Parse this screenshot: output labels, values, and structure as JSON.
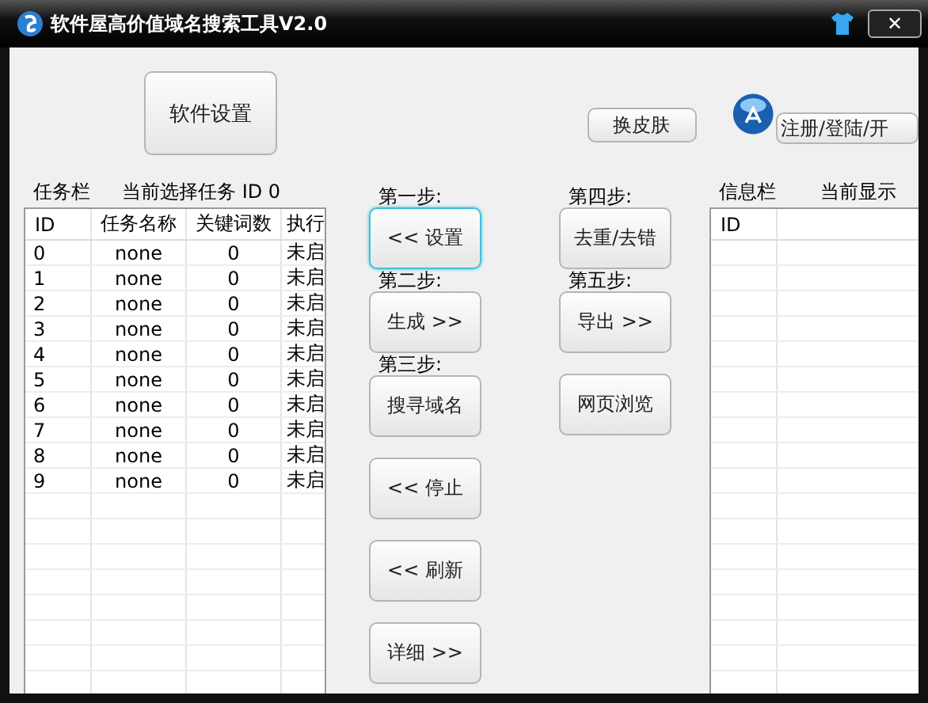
{
  "window": {
    "title": "软件屋高价值域名搜索工具V2.0",
    "close": "✕"
  },
  "toolbar": {
    "settings_button": "软件设置",
    "skin_button": "换皮肤",
    "login_button": "注册/登陆/开"
  },
  "task_panel": {
    "title": "任务栏",
    "current": "当前选择任务 ID 0",
    "columns": [
      "ID",
      "任务名称",
      "关键词数",
      "执行"
    ],
    "rows": [
      [
        "0",
        "none",
        "0",
        "未启"
      ],
      [
        "1",
        "none",
        "0",
        "未启"
      ],
      [
        "2",
        "none",
        "0",
        "未启"
      ],
      [
        "3",
        "none",
        "0",
        "未启"
      ],
      [
        "4",
        "none",
        "0",
        "未启"
      ],
      [
        "5",
        "none",
        "0",
        "未启"
      ],
      [
        "6",
        "none",
        "0",
        "未启"
      ],
      [
        "7",
        "none",
        "0",
        "未启"
      ],
      [
        "8",
        "none",
        "0",
        "未启"
      ],
      [
        "9",
        "none",
        "0",
        "未启"
      ]
    ]
  },
  "steps": [
    [
      {
        "kind": "label",
        "text": "第一步:"
      },
      {
        "kind": "button",
        "text": "<< 设置",
        "focused": true
      },
      {
        "kind": "label",
        "text": "第二步:"
      },
      {
        "kind": "button",
        "text": "生成 >>",
        "focused": false
      },
      {
        "kind": "label",
        "text": "第三步:"
      },
      {
        "kind": "button",
        "text": "搜寻域名",
        "focused": false
      },
      {
        "kind": "button",
        "text": "<< 停止",
        "focused": false
      },
      {
        "kind": "button",
        "text": "<< 刷新",
        "focused": false
      },
      {
        "kind": "button",
        "text": "详细 >>",
        "focused": false
      }
    ],
    [
      {
        "kind": "label",
        "text": "第四步:"
      },
      {
        "kind": "button",
        "text": "去重/去错",
        "focused": false
      },
      {
        "kind": "label",
        "text": "第五步:"
      },
      {
        "kind": "button",
        "text": "导出 >>",
        "focused": false
      },
      {
        "kind": "button",
        "text": "网页浏览",
        "focused": false
      }
    ]
  ],
  "info_panel": {
    "title": "信息栏",
    "current": "当前显示",
    "columns": [
      "ID"
    ]
  }
}
